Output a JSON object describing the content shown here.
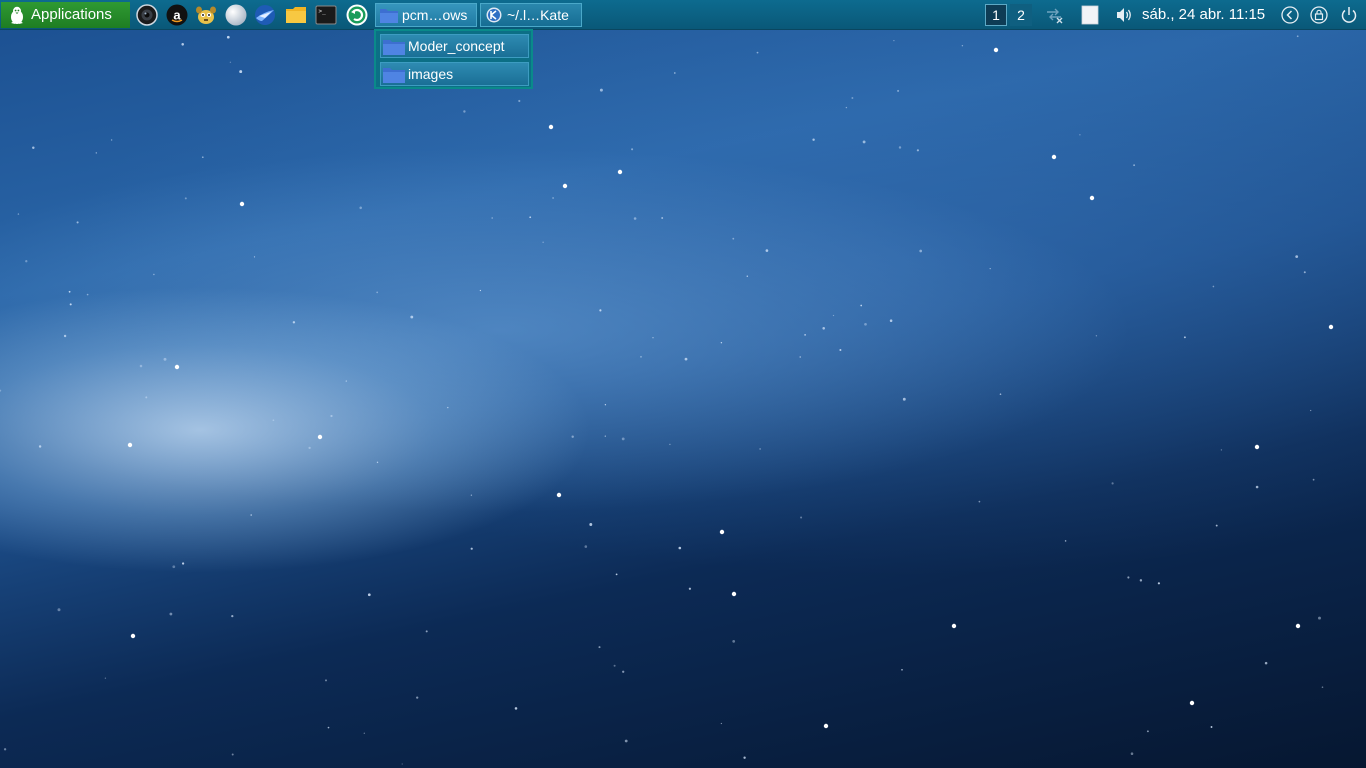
{
  "panel": {
    "applications_label": "Applications",
    "launchers": [
      {
        "name": "webcam-icon"
      },
      {
        "name": "amazon-icon"
      },
      {
        "name": "gimp-icon"
      },
      {
        "name": "globe-icon"
      },
      {
        "name": "thunderbird-icon"
      },
      {
        "name": "file-manager-icon"
      },
      {
        "name": "terminal-icon"
      },
      {
        "name": "update-manager-icon"
      }
    ],
    "tasks": [
      {
        "label": "pcm…ows",
        "icon": "folder-icon",
        "active": true
      },
      {
        "label": "~/.l…Kate",
        "icon": "kate-icon",
        "active": false
      }
    ],
    "workspaces": [
      "1",
      "2"
    ],
    "tray": {
      "network": "network-disconnected-icon",
      "clipboard": "clipboard-icon",
      "volume": "volume-icon"
    },
    "clock": "sáb., 24 abr. 11:15",
    "buttons": [
      "back-icon",
      "lock-icon",
      "power-icon"
    ]
  },
  "group_popup": {
    "items": [
      {
        "label": "Moder_concept",
        "icon": "folder-icon"
      },
      {
        "label": "images",
        "icon": "folder-icon"
      }
    ]
  },
  "colors": {
    "panel": "#0b6283",
    "applications_button": "#26892a",
    "task_button": "#1f7aa3",
    "wallpaper_dark": "#061731",
    "wallpaper_light": "#cfe4f8"
  }
}
